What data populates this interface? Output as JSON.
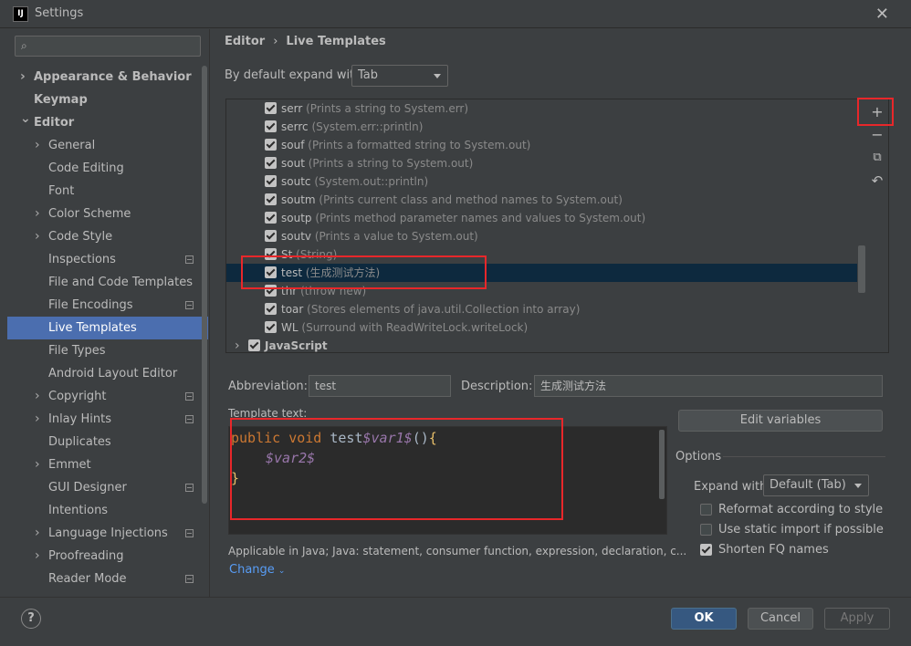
{
  "window": {
    "title": "Settings",
    "app_icon_text": "IJ"
  },
  "sidebar": {
    "search_placeholder": "",
    "items": [
      {
        "label": "Appearance & Behavior",
        "level": 0,
        "arrow": ">",
        "bold": true
      },
      {
        "label": "Keymap",
        "level": 0,
        "bold": true
      },
      {
        "label": "Editor",
        "level": 0,
        "arrow": "v",
        "bold": true
      },
      {
        "label": "General",
        "level": 1,
        "arrow": ">"
      },
      {
        "label": "Code Editing",
        "level": 1
      },
      {
        "label": "Font",
        "level": 1
      },
      {
        "label": "Color Scheme",
        "level": 1,
        "arrow": ">"
      },
      {
        "label": "Code Style",
        "level": 1,
        "arrow": ">"
      },
      {
        "label": "Inspections",
        "level": 1,
        "project": true
      },
      {
        "label": "File and Code Templates",
        "level": 1
      },
      {
        "label": "File Encodings",
        "level": 1,
        "project": true
      },
      {
        "label": "Live Templates",
        "level": 1,
        "selected": true
      },
      {
        "label": "File Types",
        "level": 1
      },
      {
        "label": "Android Layout Editor",
        "level": 1
      },
      {
        "label": "Copyright",
        "level": 1,
        "arrow": ">",
        "project": true
      },
      {
        "label": "Inlay Hints",
        "level": 1,
        "arrow": ">",
        "project": true
      },
      {
        "label": "Duplicates",
        "level": 1
      },
      {
        "label": "Emmet",
        "level": 1,
        "arrow": ">"
      },
      {
        "label": "GUI Designer",
        "level": 1,
        "project": true
      },
      {
        "label": "Intentions",
        "level": 1
      },
      {
        "label": "Language Injections",
        "level": 1,
        "arrow": ">",
        "project": true
      },
      {
        "label": "Proofreading",
        "level": 1,
        "arrow": ">"
      },
      {
        "label": "Reader Mode",
        "level": 1,
        "project": true
      }
    ]
  },
  "breadcrumb": {
    "parent": "Editor",
    "separator": "›",
    "current": "Live Templates"
  },
  "expand": {
    "label": "By default expand with",
    "value": "Tab"
  },
  "templates": [
    {
      "abbr": "serr",
      "desc": "(Prints a string to System.err)"
    },
    {
      "abbr": "serrc",
      "desc": "(System.err::println)"
    },
    {
      "abbr": "souf",
      "desc": "(Prints a formatted string to System.out)"
    },
    {
      "abbr": "sout",
      "desc": "(Prints a string to System.out)"
    },
    {
      "abbr": "soutc",
      "desc": "(System.out::println)"
    },
    {
      "abbr": "soutm",
      "desc": "(Prints current class and method names to System.out)"
    },
    {
      "abbr": "soutp",
      "desc": "(Prints method parameter names and values to System.out)"
    },
    {
      "abbr": "soutv",
      "desc": "(Prints a value to System.out)"
    },
    {
      "abbr": "St",
      "desc": "(String)"
    },
    {
      "abbr": "test",
      "desc": "(生成测试方法)",
      "selected": true
    },
    {
      "abbr": "thr",
      "desc": "(throw new)"
    },
    {
      "abbr": "toar",
      "desc": "(Stores elements of java.util.Collection into array)"
    },
    {
      "abbr": "WL",
      "desc": "(Surround with ReadWriteLock.writeLock)"
    }
  ],
  "template_group": {
    "label": "JavaScript",
    "arrow": ">"
  },
  "toolbar": {
    "add": "+",
    "remove": "−",
    "copy": "⧉",
    "restore": "↶"
  },
  "abbreviation": {
    "label": "Abbreviation:",
    "value": "test"
  },
  "description": {
    "label": "Description:",
    "value": "生成测试方法"
  },
  "template_text": {
    "label": "Template text:",
    "line1_kw1": "public",
    "line1_kw2": "void",
    "line1_name": "test",
    "line1_var": "$var1$",
    "line1_paren": "()",
    "line1_brace": "{",
    "line2_var": "$var2$",
    "line3_brace": "}"
  },
  "edit_variables": "Edit variables",
  "options": {
    "title": "Options",
    "expand_label": "Expand with",
    "expand_value": "Default (Tab)",
    "reformat": {
      "label": "Reformat according to style",
      "checked": false
    },
    "static_import": {
      "label": "Use static import if possible",
      "checked": false
    },
    "shorten_fq": {
      "label": "Shorten FQ names",
      "checked": true
    }
  },
  "applicable": "Applicable in Java; Java: statement, consumer function, expression, declaration, c...",
  "change_link": "Change",
  "footer": {
    "help": "?",
    "ok": "OK",
    "cancel": "Cancel",
    "apply": "Apply"
  },
  "colors": {
    "accent_blue": "#4b6eaf",
    "highlight_red": "#e8272a",
    "link": "#589df6"
  }
}
